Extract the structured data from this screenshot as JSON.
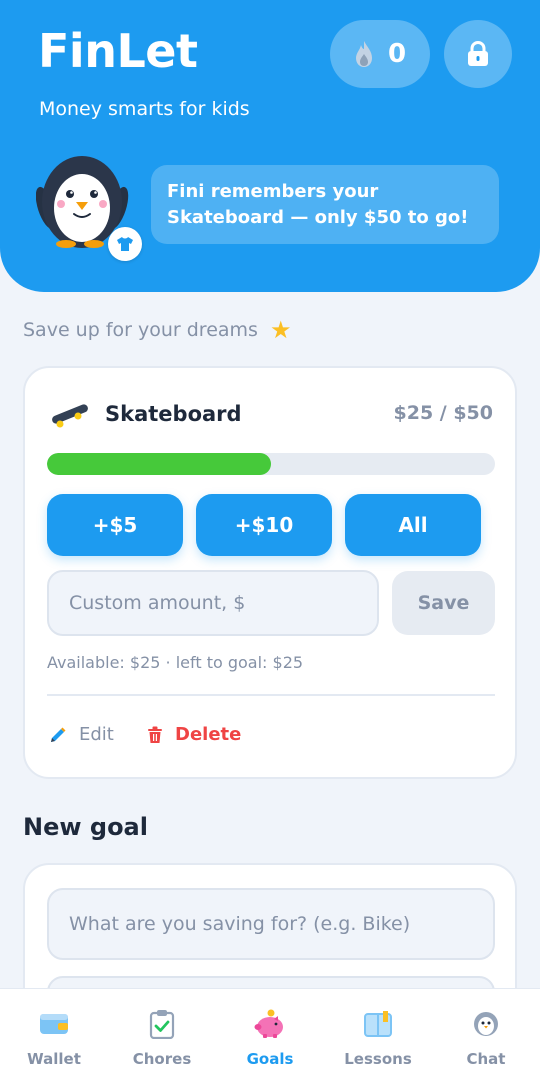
{
  "app": {
    "title": "FinLet",
    "subtitle": "Money smarts for kids"
  },
  "header": {
    "streak_count": "0",
    "streak_icon": "flame-icon",
    "lock_icon": "lock-icon"
  },
  "mascot": {
    "message": "Fini remembers your Skateboard — only $50 to go!",
    "badge_icon": "shirt-icon"
  },
  "goals_section": {
    "label": "Save up for your dreams"
  },
  "goal": {
    "name": "Skateboard",
    "amount_text": "$25 / $50",
    "saved": 25,
    "target": 50,
    "progress_fraction": 0.5,
    "quick_buttons": [
      "+$5",
      "+$10",
      "All"
    ],
    "custom_placeholder": "Custom amount, $",
    "save_label": "Save",
    "available_text": "Available: $25 · left to goal: $25",
    "edit_label": "Edit",
    "delete_label": "Delete"
  },
  "new_goal": {
    "title": "New goal",
    "name_placeholder": "What are you saving for? (e.g. Bike)"
  },
  "tabs": [
    {
      "label": "Wallet",
      "icon": "wallet-icon",
      "active": false
    },
    {
      "label": "Chores",
      "icon": "clipboard-check-icon",
      "active": false
    },
    {
      "label": "Goals",
      "icon": "piggy-bank-icon",
      "active": true
    },
    {
      "label": "Lessons",
      "icon": "book-icon",
      "active": false
    },
    {
      "label": "Chat",
      "icon": "penguin-icon",
      "active": false
    }
  ],
  "colors": {
    "primary": "#1d9bf0",
    "progress": "#46c93a",
    "danger": "#ef4444",
    "muted": "#8591a6"
  }
}
